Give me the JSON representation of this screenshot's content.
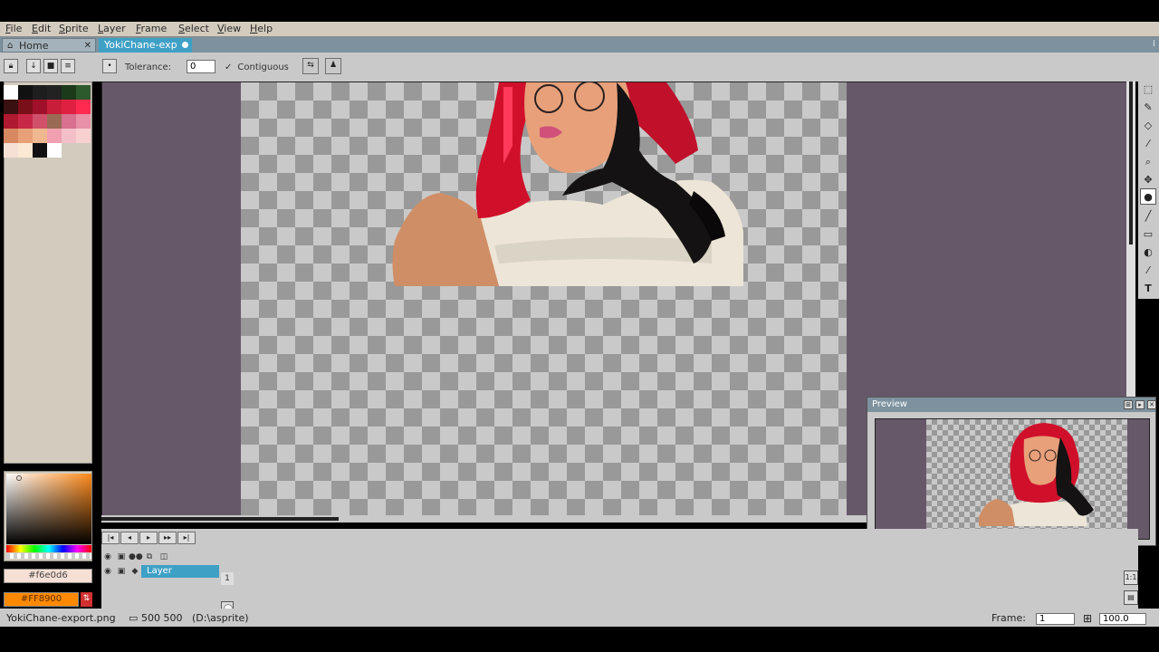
{
  "menu": [
    "File",
    "Edit",
    "Sprite",
    "Layer",
    "Frame",
    "Select",
    "View",
    "Help"
  ],
  "tabs": {
    "home_label": "Home",
    "file_label": "YokiChane-exp"
  },
  "toolbar": {
    "tolerance_label": "Tolerance:",
    "tolerance_value": "0",
    "contiguous_label": "Contiguous"
  },
  "palette": {
    "colors": [
      "#ffffff",
      "#111111",
      "#1e1e1e",
      "#222222",
      "#1a3a1a",
      "#2d5a2d",
      "#3a1010",
      "#7a0f1a",
      "#a0102a",
      "#c81e3a",
      "#e02040",
      "#ff2a50",
      "#b01a30",
      "#c82848",
      "#d0506a",
      "#9a6a55",
      "#d87090",
      "#e890a8",
      "#d88860",
      "#e8a078",
      "#f0b890",
      "#f0a0b0",
      "#f4c0c8",
      "#f8d0d0",
      "#f6e0d6",
      "#fbe9d4",
      "#111111",
      "#ffffff"
    ]
  },
  "colors": {
    "fg_hex": "#f6e0d6",
    "bg_hex": "#FF8900",
    "accent": "#3fa0c5",
    "canvas_bg": "#665869"
  },
  "preview": {
    "title": "Preview"
  },
  "timeline": {
    "frame_number": "1",
    "layer_name": "Layer"
  },
  "status": {
    "filename": "YokiChane-export.png",
    "size": "500 500",
    "path": "(D:\\asprite)",
    "frame_label": "Frame:",
    "frame_value": "1",
    "zoom_value": "100.0"
  }
}
